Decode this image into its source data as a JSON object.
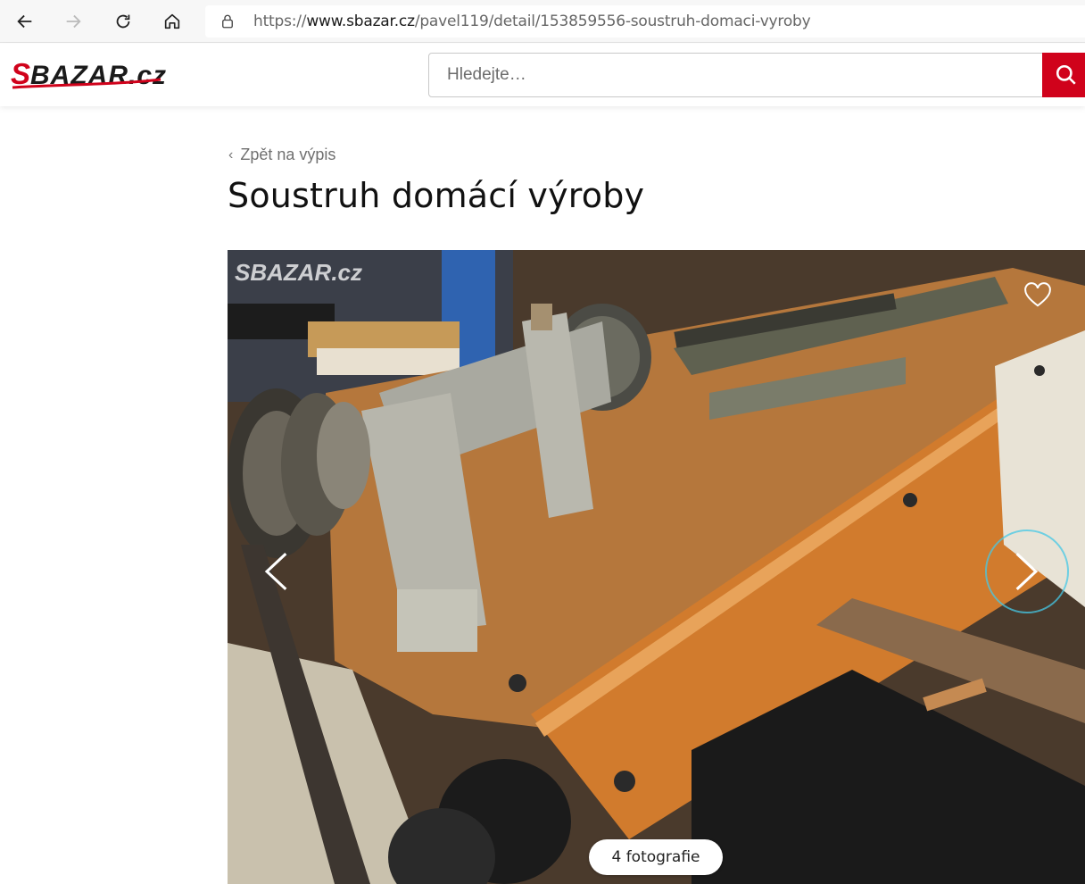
{
  "browser": {
    "url_prefix": "https://",
    "url_host": "www.sbazar.cz",
    "url_path": "/pavel119/detail/153859556-soustruh-domaci-vyroby"
  },
  "header": {
    "logo_text": "SBAZAR.cz",
    "search_placeholder": "Hledejte…",
    "accent_color": "#d0021b"
  },
  "main": {
    "back_link": "Zpět na výpis",
    "title": "Soustruh domácí výroby"
  },
  "gallery": {
    "watermark": "SBAZAR.cz",
    "photo_count_label": "4 fotografie",
    "icons": {
      "favorite": "heart-icon",
      "prev": "chevron-left-icon",
      "next": "chevron-right-icon"
    }
  }
}
